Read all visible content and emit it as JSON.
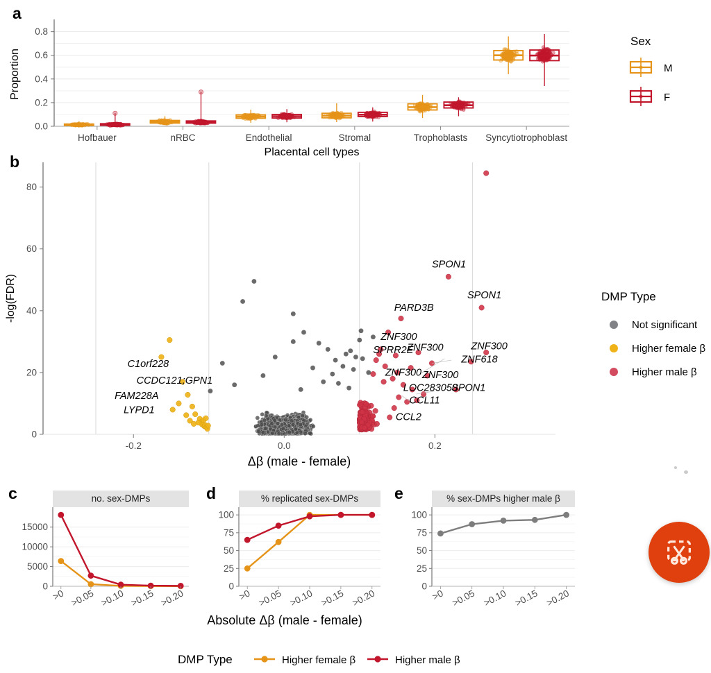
{
  "figure": {
    "panels": [
      "a",
      "b",
      "c",
      "d",
      "e"
    ]
  },
  "panel_a": {
    "letter": "a",
    "ylabel": "Proportion",
    "xlabel": "Placental cell types",
    "legend_title": "Sex",
    "legend_items": [
      {
        "label": "M",
        "color": "#e59419"
      },
      {
        "label": "F",
        "color": "#c1162c"
      }
    ],
    "yticks": [
      "0.0",
      "0.2",
      "0.4",
      "0.6",
      "0.8"
    ],
    "chart_data": {
      "type": "box",
      "title": "",
      "xlabel": "Placental cell types",
      "ylabel": "Proportion",
      "ylim": [
        0,
        0.88
      ],
      "categories": [
        "Hofbauer",
        "nRBC",
        "Endothelial",
        "Stromal",
        "Trophoblasts",
        "Syncytiotrophoblast"
      ],
      "series": [
        {
          "name": "M",
          "color": "#e59419",
          "boxes": [
            {
              "category": "Hofbauer",
              "min": 0.002,
              "q1": 0.008,
              "median": 0.013,
              "q3": 0.019,
              "max": 0.042
            },
            {
              "category": "nRBC",
              "min": 0.01,
              "q1": 0.027,
              "median": 0.037,
              "q3": 0.049,
              "max": 0.085
            },
            {
              "category": "Endothelial",
              "min": 0.03,
              "q1": 0.068,
              "median": 0.082,
              "q3": 0.097,
              "max": 0.14
            },
            {
              "category": "Stromal",
              "min": 0.035,
              "q1": 0.072,
              "median": 0.09,
              "q3": 0.11,
              "max": 0.195
            },
            {
              "category": "Trophoblasts",
              "min": 0.07,
              "q1": 0.138,
              "median": 0.162,
              "q3": 0.19,
              "max": 0.265
            },
            {
              "category": "Syncytiotrophoblast",
              "min": 0.44,
              "q1": 0.56,
              "median": 0.6,
              "q3": 0.64,
              "max": 0.76
            }
          ]
        },
        {
          "name": "F",
          "color": "#c1162c",
          "boxes": [
            {
              "category": "Hofbauer",
              "min": 0.002,
              "q1": 0.009,
              "median": 0.015,
              "q3": 0.022,
              "max": 0.11
            },
            {
              "category": "nRBC",
              "min": 0.01,
              "q1": 0.026,
              "median": 0.034,
              "q3": 0.045,
              "max": 0.29
            },
            {
              "category": "Endothelial",
              "min": 0.034,
              "q1": 0.07,
              "median": 0.085,
              "q3": 0.1,
              "max": 0.145
            },
            {
              "category": "Stromal",
              "min": 0.04,
              "q1": 0.082,
              "median": 0.098,
              "q3": 0.118,
              "max": 0.16
            },
            {
              "category": "Trophoblasts",
              "min": 0.085,
              "q1": 0.155,
              "median": 0.178,
              "q3": 0.205,
              "max": 0.245
            },
            {
              "category": "Syncytiotrophoblast",
              "min": 0.34,
              "q1": 0.555,
              "median": 0.598,
              "q3": 0.645,
              "max": 0.78
            }
          ]
        }
      ]
    }
  },
  "panel_b": {
    "letter": "b",
    "ylabel": "-log(FDR)",
    "xlabel": "Δβ (male - female)",
    "legend_title": "DMP Type",
    "legend_items": [
      {
        "label": "Not significant",
        "color": "#808285"
      },
      {
        "label": "Higher female β",
        "color": "#efb319"
      },
      {
        "label": "Higher male β",
        "color": "#d24b5e"
      }
    ],
    "yticks": [
      "0",
      "20",
      "40",
      "60",
      "80"
    ],
    "xticks": [
      "-0.2",
      "0.0",
      "0.2"
    ],
    "chart_data": {
      "type": "scatter",
      "title": "",
      "xlabel": "Δβ (male - female)",
      "ylabel": "-log(FDR)",
      "xlim": [
        -0.32,
        0.36
      ],
      "ylim": [
        0,
        88
      ],
      "threshold_lines_x": [
        -0.25,
        -0.1,
        0.1,
        0.25
      ],
      "legend_position": "right",
      "labeled_points": [
        {
          "gene": "C1orf228",
          "x": -0.148,
          "y": 21.5,
          "group": "Higher female β"
        },
        {
          "gene": "CCDC121;GPN1",
          "x": -0.128,
          "y": 16.0,
          "group": "Higher female β"
        },
        {
          "gene": "FAM228A",
          "x": -0.14,
          "y": 11.0,
          "group": "Higher female β"
        },
        {
          "gene": "LYPD1",
          "x": -0.132,
          "y": 6.5,
          "group": "Higher female β"
        },
        {
          "gene": "SPON1",
          "x": 0.218,
          "y": 51.0,
          "group": "Higher male β"
        },
        {
          "gene": "SPON1",
          "x": 0.262,
          "y": 41.0,
          "group": "Higher male β"
        },
        {
          "gene": "PARD3B",
          "x": 0.155,
          "y": 37.5,
          "group": "Higher male β"
        },
        {
          "gene": "ZNF300",
          "x": 0.138,
          "y": 33.0,
          "group": "Higher male β"
        },
        {
          "gene": "SPRR2E",
          "x": 0.148,
          "y": 25.5,
          "group": "Higher male β"
        },
        {
          "gene": "ZNF300",
          "x": 0.178,
          "y": 26.5,
          "group": "Higher male β"
        },
        {
          "gene": "ZNF300",
          "x": 0.268,
          "y": 26.5,
          "group": "Higher male β"
        },
        {
          "gene": "ZNF618",
          "x": 0.248,
          "y": 23.5,
          "group": "Higher male β"
        },
        {
          "gene": "ZNF300",
          "x": 0.15,
          "y": 20.0,
          "group": "Higher male β"
        },
        {
          "gene": "ZNF300",
          "x": 0.19,
          "y": 19.0,
          "group": "Higher male β"
        },
        {
          "gene": "LOC283050",
          "x": 0.17,
          "y": 14.5,
          "group": "Higher male β"
        },
        {
          "gene": "SPON1",
          "x": 0.228,
          "y": 14.5,
          "group": "Higher male β"
        },
        {
          "gene": "CCL11",
          "x": 0.163,
          "y": 10.5,
          "group": "Higher male β"
        },
        {
          "gene": "CCL2",
          "x": 0.14,
          "y": 5.5,
          "group": "Higher male β"
        },
        {
          "gene": "",
          "x": 0.268,
          "y": 84.5,
          "group": "Higher male β"
        }
      ]
    }
  },
  "panel_c": {
    "letter": "c",
    "strip_title": "no. sex-DMPs",
    "yticks": [
      "0",
      "5000",
      "10000",
      "15000"
    ],
    "xticks": [
      ">0",
      ">0.05",
      ">0.10",
      ">0.15",
      ">0.20"
    ],
    "chart_data": {
      "type": "line",
      "title": "no. sex-DMPs",
      "xlabel": "Absolute Δβ (male - female)",
      "ylabel": "",
      "categories": [
        ">0",
        ">0.05",
        ">0.10",
        ">0.15",
        ">0.20"
      ],
      "ylim": [
        0,
        19000
      ],
      "series": [
        {
          "name": "Higher female β",
          "color": "#e59419",
          "values": [
            6400,
            520,
            110,
            55,
            40
          ]
        },
        {
          "name": "Higher male β",
          "color": "#c1162c",
          "values": [
            18100,
            2700,
            400,
            150,
            110
          ]
        }
      ]
    }
  },
  "panel_d": {
    "letter": "d",
    "strip_title": "% replicated sex-DMPs",
    "yticks": [
      "0",
      "25",
      "50",
      "75",
      "100"
    ],
    "xticks": [
      ">0",
      ">0.05",
      ">0.10",
      ">0.15",
      ">0.20"
    ],
    "chart_data": {
      "type": "line",
      "title": "% replicated sex-DMPs",
      "xlabel": "Absolute Δβ (male - female)",
      "ylabel": "",
      "categories": [
        ">0",
        ">0.05",
        ">0.10",
        ">0.15",
        ">0.20"
      ],
      "ylim": [
        0,
        105
      ],
      "series": [
        {
          "name": "Higher female β",
          "color": "#e59419",
          "values": [
            25,
            62,
            100,
            100,
            100
          ]
        },
        {
          "name": "Higher male β",
          "color": "#c1162c",
          "values": [
            65,
            85,
            98,
            100,
            100
          ]
        }
      ]
    }
  },
  "panel_e": {
    "letter": "e",
    "strip_title": "% sex-DMPs higher male β",
    "yticks": [
      "0",
      "25",
      "50",
      "75",
      "100"
    ],
    "xticks": [
      ">0",
      ">0.05",
      ">0.10",
      ">0.15",
      ">0.20"
    ],
    "chart_data": {
      "type": "line",
      "title": "% sex-DMPs higher male β",
      "xlabel": "Absolute Δβ (male - female)",
      "ylabel": "",
      "categories": [
        ">0",
        ">0.05",
        ">0.10",
        ">0.15",
        ">0.20"
      ],
      "ylim": [
        0,
        105
      ],
      "series": [
        {
          "name": "",
          "color": "#7d7d7d",
          "values": [
            74,
            87,
            92,
            93,
            100
          ]
        }
      ]
    }
  },
  "bottom": {
    "xlabel": "Absolute Δβ (male - female)",
    "legend_title": "DMP Type",
    "legend_items": [
      {
        "label": "Higher female β",
        "color": "#e59419"
      },
      {
        "label": "Higher male β",
        "color": "#c1162c"
      }
    ]
  },
  "overlay": {
    "snip_button": "snip-tool-button"
  }
}
